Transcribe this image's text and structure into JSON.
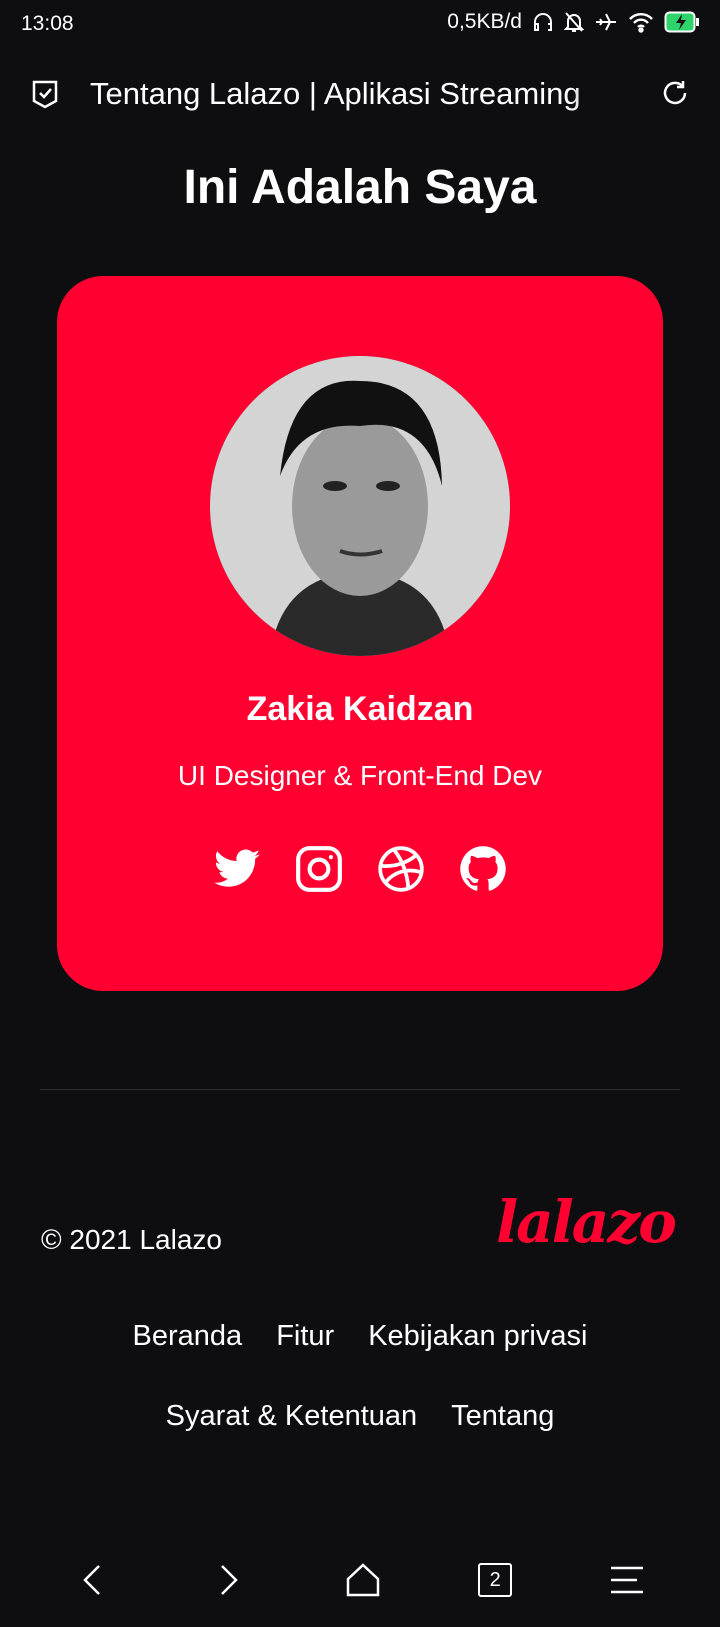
{
  "status_bar": {
    "time": "13:08",
    "network_speed": "0,5KB/d",
    "icons": [
      "headphones-icon",
      "bell-muted-icon",
      "airplane-icon",
      "wifi-icon",
      "battery-charging-icon"
    ],
    "battery_color": "#2fd36b"
  },
  "browser": {
    "page_title": "Tentang Lalazo | Aplikasi Streaming"
  },
  "main": {
    "heading": "Ini Adalah Saya",
    "profile": {
      "name": "Zakia Kaidzan",
      "role": "UI Designer & Front-End Dev",
      "social": [
        "twitter",
        "instagram",
        "dribbble",
        "github"
      ]
    }
  },
  "footer": {
    "copyright": "© 2021 Lalazo",
    "logo": "lalazo",
    "links": [
      "Beranda",
      "Fitur",
      "Kebijakan privasi",
      "Syarat & Ketentuan",
      "Tentang"
    ]
  },
  "nav": {
    "tab_count": "2"
  },
  "colors": {
    "accent": "#ff0030",
    "background": "#0e0e10"
  }
}
